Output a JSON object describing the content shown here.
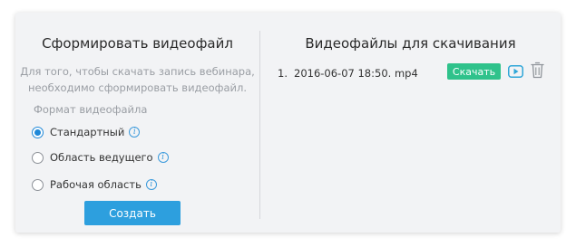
{
  "left": {
    "title": "Сформировать видеофайл",
    "hint_line1": "Для того, чтобы скачать запись вебинара,",
    "hint_line2": "необходимо сформировать видеофайл.",
    "format_label": "Формат видеофайла",
    "options": [
      {
        "label": "Стандартный",
        "checked": true
      },
      {
        "label": "Область ведущего",
        "checked": false
      },
      {
        "label": "Рабочая область",
        "checked": false
      }
    ],
    "info_glyph": "i",
    "create_button": "Создать"
  },
  "right": {
    "title": "Видеофайлы для скачивания",
    "files": [
      {
        "number": "1.",
        "name": "2016-06-07 18:50. mp4",
        "download_label": "Скачать"
      }
    ]
  },
  "icons": {
    "play": "play-icon",
    "trash": "trash-icon",
    "info": "info-icon"
  },
  "colors": {
    "panel_background": "#f2f3f5",
    "primary_button": "#2d9fde",
    "download_button": "#2fc28b",
    "radio_checked": "#1e88d8",
    "hint_text": "#9a9ea4"
  }
}
